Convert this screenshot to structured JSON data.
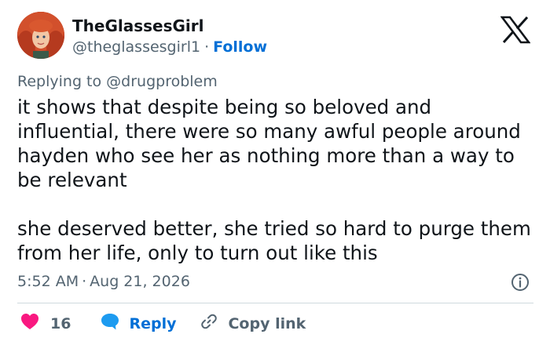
{
  "author": {
    "display_name": "TheGlassesGirl",
    "handle": "@theglassesgirl1",
    "separator": "·",
    "follow_label": "Follow"
  },
  "reply_context": {
    "prefix": "Replying to ",
    "mention": "@drugproblem"
  },
  "tweet": {
    "paragraphs": [
      "it shows that despite being so beloved and influential, there were so many awful people around hayden who see her as nothing more than a way to be relevant",
      "she deserved better, she tried so hard to purge them from her life, only to turn out like this"
    ]
  },
  "meta": {
    "time": "5:52 AM",
    "separator": "·",
    "date": "Aug 21, 2026"
  },
  "actions": {
    "like_count": "16",
    "reply_label": "Reply",
    "copy_link_label": "Copy link"
  },
  "colors": {
    "text": "#0f1419",
    "secondary": "#536471",
    "link": "#006fd6",
    "like": "#f91880",
    "divider": "#cfd9de"
  },
  "icons": {
    "logo": "x-logo-icon",
    "info": "info-icon",
    "like": "heart-icon",
    "reply": "speech-bubble-icon",
    "copy_link": "link-icon"
  }
}
